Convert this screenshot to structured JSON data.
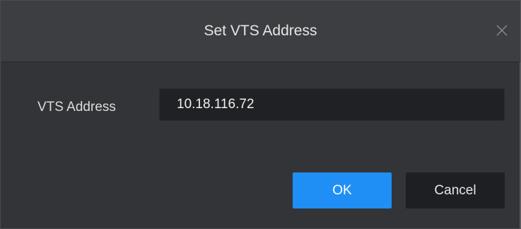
{
  "dialog": {
    "title": "Set VTS Address",
    "close_icon": "close-icon"
  },
  "form": {
    "vts_address_label": "VTS Address",
    "vts_address_value": "10.18.116.72"
  },
  "buttons": {
    "ok_label": "OK",
    "cancel_label": "Cancel"
  },
  "colors": {
    "accent": "#1f8ff5",
    "background": "#333437",
    "input_background": "#202124"
  }
}
